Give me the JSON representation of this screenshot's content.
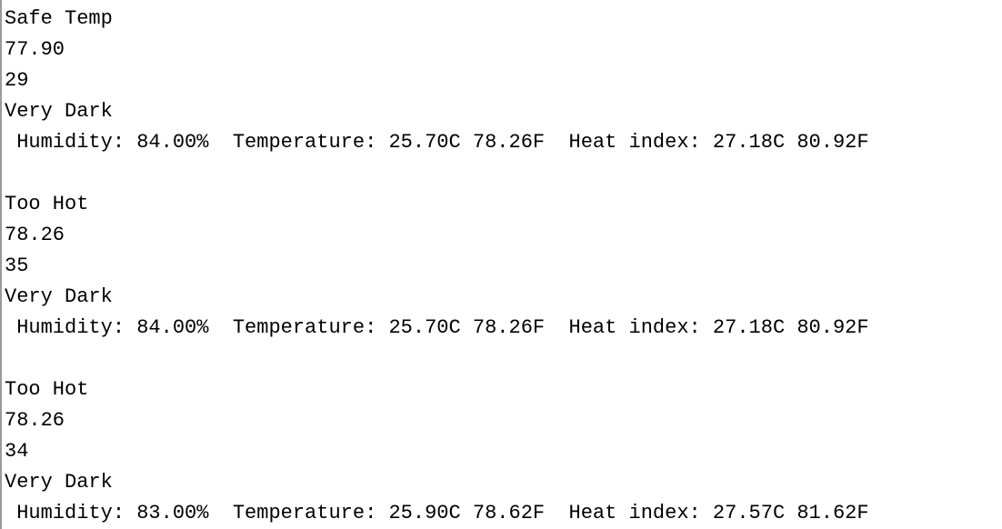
{
  "console": {
    "lines": [
      "Safe Temp",
      "77.90",
      "29",
      "Very Dark",
      " Humidity: 84.00%  Temperature: 25.70C 78.26F  Heat index: 27.18C 80.92F",
      "",
      "Too Hot",
      "78.26",
      "35",
      "Very Dark",
      " Humidity: 84.00%  Temperature: 25.70C 78.26F  Heat index: 27.18C 80.92F",
      "",
      "Too Hot",
      "78.26",
      "34",
      "Very Dark",
      " Humidity: 83.00%  Temperature: 25.90C 78.62F  Heat index: 27.57C 81.62F"
    ]
  }
}
